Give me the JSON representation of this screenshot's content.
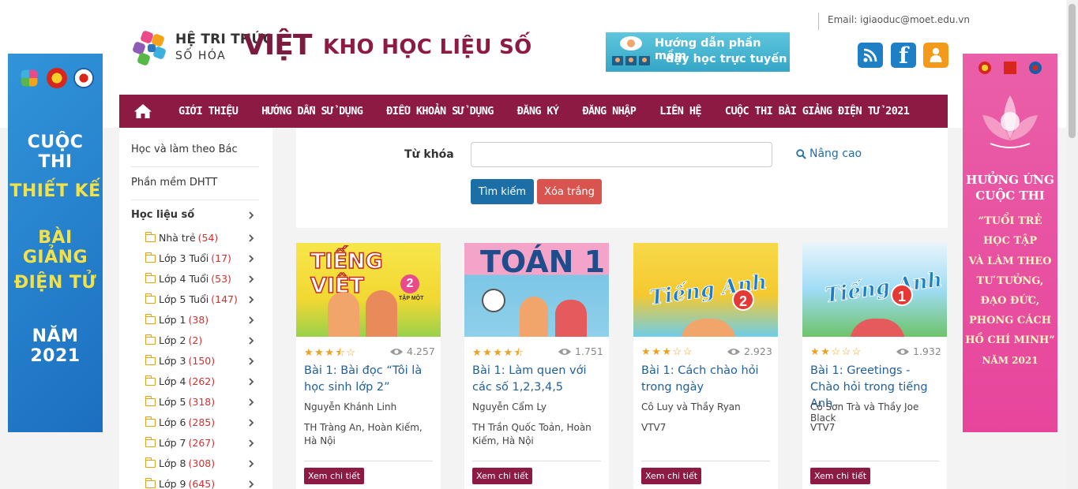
{
  "header": {
    "email": "Email: igiaoduc@moet.edu.vn",
    "logo_line1": "HỆ TRI THỨC",
    "logo_line2": "SỐ HÓA",
    "logo_line3": "VIỆT",
    "site_title": "KHO HỌC LIỆU SỐ",
    "guide_line1": "Hướng dẫn phần mềm",
    "guide_line2": "dạy học trực tuyến",
    "social_icons": [
      "rss-icon",
      "facebook-icon",
      "user-icon"
    ]
  },
  "nav": {
    "items": [
      "GIỚI THIỆU",
      "HƯỚNG DẪN SỬ DỤNG",
      "ĐIỀU KHOẢN SỬ DỤNG",
      "ĐĂNG KÝ",
      "ĐĂNG NHẬP",
      "LIÊN HỆ",
      "CUỘC THI BÀI GIẢNG ĐIỆN TỬ 2021"
    ]
  },
  "banner_left": {
    "lines": [
      "CUỘC THI",
      "THIẾT KẾ",
      "BÀI GIẢNG",
      "ĐIỆN TỬ",
      "NĂM 2021"
    ]
  },
  "banner_right": {
    "heading": [
      "HƯỞNG ỨNG",
      "CUỘC THI"
    ],
    "lines": [
      "“TUỔI TRẺ",
      "HỌC TẬP",
      "VÀ LÀM THEO",
      "TƯ TƯỞNG,",
      "ĐẠO ĐỨC,",
      "PHONG CÁCH",
      "HỒ CHÍ MINH”",
      "NĂM 2021"
    ]
  },
  "sidebar": {
    "links": [
      "Học và làm theo Bác",
      "Phần mềm DHTT"
    ],
    "heading": "Học liệu số",
    "items": [
      {
        "label": "Nhà trẻ",
        "count": "(54)"
      },
      {
        "label": "Lớp 3 Tuổi",
        "count": "(17)"
      },
      {
        "label": "Lớp 4 Tuổi",
        "count": "(53)"
      },
      {
        "label": "Lớp 5 Tuổi",
        "count": "(147)"
      },
      {
        "label": "Lớp 1",
        "count": "(38)"
      },
      {
        "label": "Lớp 2",
        "count": "(2)"
      },
      {
        "label": "Lớp 3",
        "count": "(150)"
      },
      {
        "label": "Lớp 4",
        "count": "(262)"
      },
      {
        "label": "Lớp 5",
        "count": "(318)"
      },
      {
        "label": "Lớp 6",
        "count": "(285)"
      },
      {
        "label": "Lớp 7",
        "count": "(267)"
      },
      {
        "label": "Lớp 8",
        "count": "(308)"
      },
      {
        "label": "Lớp 9",
        "count": "(645)"
      }
    ]
  },
  "search": {
    "keyword_label": "Từ khóa",
    "keyword_value": "",
    "advanced_label": "Nâng cao",
    "search_button": "Tìm kiếm",
    "clear_button": "Xóa trắng"
  },
  "cards": [
    {
      "cover_title": "TIẾNG VIỆT",
      "cover_sub": "TẬP MỘT",
      "cover_num": "2",
      "rating": 3.5,
      "views": "4.257",
      "title": "Bài 1: Bài đọc “Tôi là học sinh lớp 2”",
      "author": "Nguyễn Khánh Linh",
      "org": "TH Tràng An, Hoàn Kiếm, Hà Nội",
      "button": "Xem chi tiết"
    },
    {
      "cover_title": "TOÁN 1",
      "cover_sub": "",
      "cover_num": "",
      "rating": 4.5,
      "views": "1.751",
      "title": "Bài 1: Làm quen với các số 1,2,3,4,5",
      "author": "Nguyễn Cẩm Ly",
      "org": "TH Trần Quốc Toản, Hoàn Kiếm, Hà Nội",
      "button": "Xem chi tiết"
    },
    {
      "cover_title": "Tiếng Anh",
      "cover_sub": "",
      "cover_num": "2",
      "rating": 3,
      "views": "2.923",
      "title": "Bài 1: Cách chào hỏi trong ngày",
      "author": "Cô Luy và Thầy Ryan",
      "org": "VTV7",
      "button": "Xem chi tiết"
    },
    {
      "cover_title": "Tiếng Anh",
      "cover_sub": "",
      "cover_num": "1",
      "rating": 2,
      "views": "1.932",
      "title": "Bài 1: Greetings - Chào hỏi trong tiếng Anh",
      "author": "Cô Sơn Trà và Thầy Joe Black",
      "org": "VTV7",
      "button": "Xem chi tiết"
    }
  ],
  "colors": {
    "brand": "#8c1a43",
    "link": "#1f5f9a",
    "primary_button": "#1b6fa6",
    "danger_button": "#d9534f",
    "count": "#d32f2f",
    "star": "#f0a020"
  }
}
